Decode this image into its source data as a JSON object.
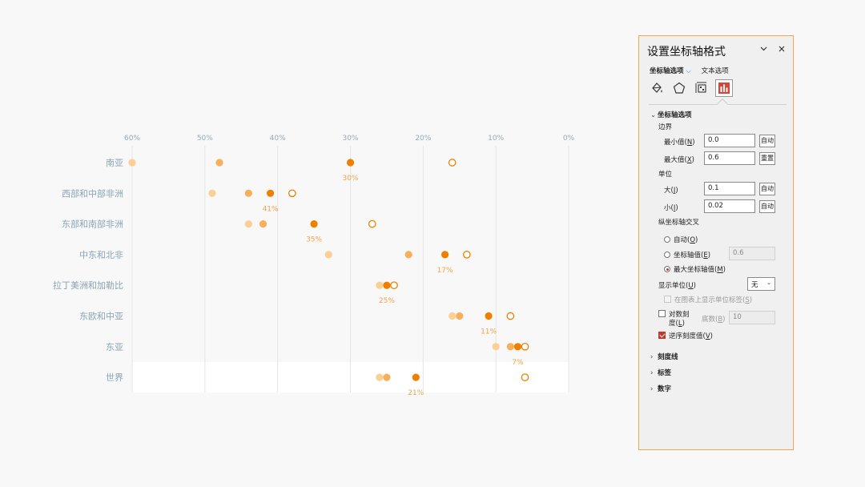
{
  "chart_data": {
    "type": "scatter",
    "xlim": [
      0,
      0.6
    ],
    "x_reversed": true,
    "x_ticks": [
      "60%",
      "50%",
      "40%",
      "30%",
      "20%",
      "10%",
      "0%"
    ],
    "x_tick_values": [
      0.6,
      0.5,
      0.4,
      0.3,
      0.2,
      0.1,
      0.0
    ],
    "grid": "vertical",
    "highlight_row": "世界",
    "categories": [
      "南亚",
      "西部和中部非洲",
      "东部和南部非洲",
      "中东和北非",
      "拉丁美洲和加勒比",
      "东欧和中亚",
      "东亚",
      "世界"
    ],
    "series": [
      {
        "style": "light",
        "color": "#fbcf96",
        "values": [
          0.6,
          0.49,
          0.44,
          0.33,
          0.26,
          0.16,
          0.1,
          0.26
        ]
      },
      {
        "style": "medium",
        "color": "#f8ae5a",
        "values": [
          0.48,
          0.44,
          0.42,
          0.22,
          0.24,
          0.15,
          0.08,
          0.25
        ]
      },
      {
        "style": "dark",
        "color": "#f07f00",
        "values": [
          0.3,
          0.41,
          0.35,
          0.17,
          0.25,
          0.11,
          0.07,
          0.21
        ]
      },
      {
        "style": "hollow",
        "color": "#f07f00",
        "values": [
          0.16,
          0.38,
          0.27,
          0.14,
          0.24,
          0.08,
          0.06,
          0.06
        ]
      }
    ],
    "data_labels": [
      "30%",
      "41%",
      "35%",
      "17%",
      "25%",
      "11%",
      "7%",
      "21%"
    ],
    "colors": {
      "label": "#8aa4b6",
      "axis_tick": "#9aa8b2",
      "data_label": "#f3a24b",
      "grid": "#e4e6e6"
    }
  },
  "pane": {
    "title": "设置坐标轴格式",
    "collapse_icon": "chevron-down-icon",
    "close_icon": "close-icon",
    "tabs": {
      "axis_options": "坐标轴选项",
      "text_options": "文本选项"
    },
    "icons": [
      "fill-bucket-icon",
      "pentagon-icon",
      "size-properties-icon",
      "bar-chart-icon"
    ],
    "section_axis": "坐标轴选项",
    "bounds": {
      "label": "边界",
      "min_label": "最小值(",
      "min_key": "N",
      "min_value": "0.0",
      "min_btn": "自动",
      "max_label": "最大值(",
      "max_key": "X",
      "max_value": "0.6",
      "max_btn": "重置"
    },
    "units": {
      "label": "单位",
      "major_label": "大(",
      "major_key": "J",
      "major_value": "0.1",
      "major_btn": "自动",
      "minor_label": "小(",
      "minor_key": "I",
      "minor_value": "0.02",
      "minor_btn": "自动"
    },
    "cross": {
      "label": "纵坐标轴交叉",
      "auto_label": "自动(",
      "auto_key": "O",
      "value_label": "坐标轴值(",
      "value_key": "E",
      "value_field": "0.6",
      "max_label": "最大坐标轴值(",
      "max_key": "M",
      "selected": "max"
    },
    "display_units": {
      "label": "显示单位(",
      "key": "U",
      "value": "无",
      "show_label_text": "在图表上显示单位标签(",
      "show_label_key": "S"
    },
    "log_scale": {
      "label_line1": "对数刻",
      "label_line2": "度(",
      "key": "L",
      "base_label": "底数(",
      "base_key": "B",
      "base_value": "10",
      "checked": false
    },
    "reverse": {
      "label": "逆序刻度值(",
      "key": "V",
      "checked": true
    },
    "sections_collapsed": [
      "刻度线",
      "标签",
      "数字"
    ],
    "accent_color": "#c0392b",
    "border_color": "#f3a64c"
  }
}
